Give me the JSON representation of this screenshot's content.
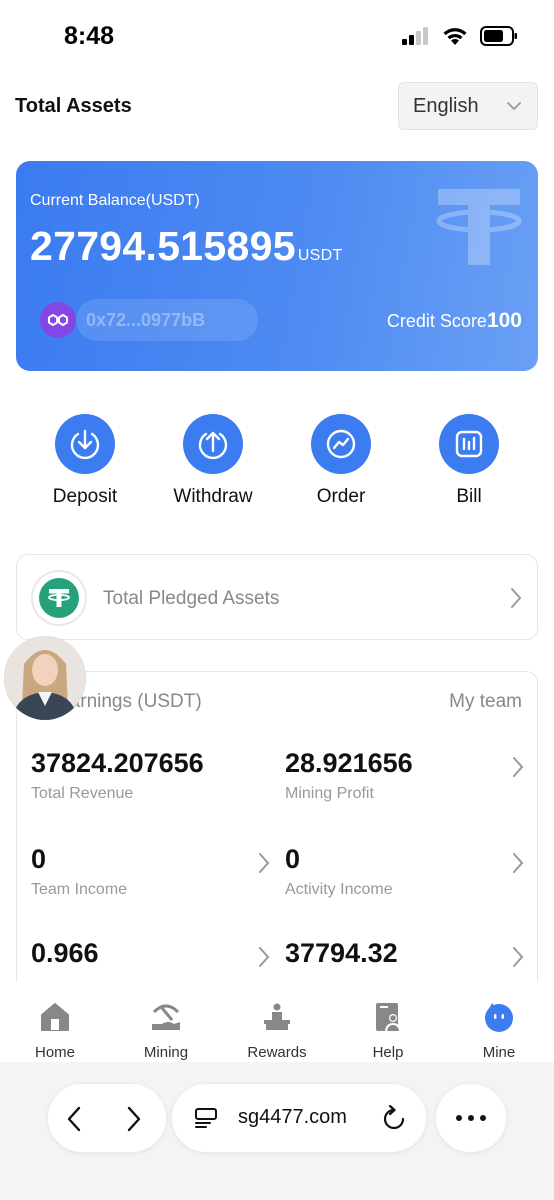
{
  "status_bar": {
    "time": "8:48"
  },
  "header": {
    "title": "Total Assets",
    "language": "English"
  },
  "balance": {
    "label": "Current Balance(USDT)",
    "amount": "27794.515895",
    "unit": "USDT",
    "wallet": "0x72...0977bB",
    "credit_label": "Credit Score",
    "credit_value": "100"
  },
  "actions": [
    {
      "label": "Deposit",
      "icon": "deposit-icon"
    },
    {
      "label": "Withdraw",
      "icon": "withdraw-icon"
    },
    {
      "label": "Order",
      "icon": "order-icon"
    },
    {
      "label": "Bill",
      "icon": "bill-icon"
    }
  ],
  "pledged": {
    "label": "Total Pledged Assets"
  },
  "earnings": {
    "title": "Earnings (USDT)",
    "team_link": "My team",
    "stats": [
      {
        "value": "37824.207656",
        "label": "Total Revenue"
      },
      {
        "value": "28.921656",
        "label": "Mining Profit"
      },
      {
        "value": "0",
        "label": "Team Income"
      },
      {
        "value": "0",
        "label": "Activity Income"
      },
      {
        "value": "0.966",
        "label": ""
      },
      {
        "value": "37794.32",
        "label": ""
      }
    ]
  },
  "tabs": [
    {
      "label": "Home",
      "icon": "home-icon"
    },
    {
      "label": "Mining",
      "icon": "mining-icon"
    },
    {
      "label": "Rewards",
      "icon": "rewards-icon"
    },
    {
      "label": "Help",
      "icon": "help-icon"
    },
    {
      "label": "Mine",
      "icon": "mine-icon",
      "active": true
    }
  ],
  "browser": {
    "url": "sg4477.com"
  },
  "colors": {
    "accent": "#3b7cf0",
    "tether": "#26a17b",
    "polygon": "#8247e5"
  }
}
